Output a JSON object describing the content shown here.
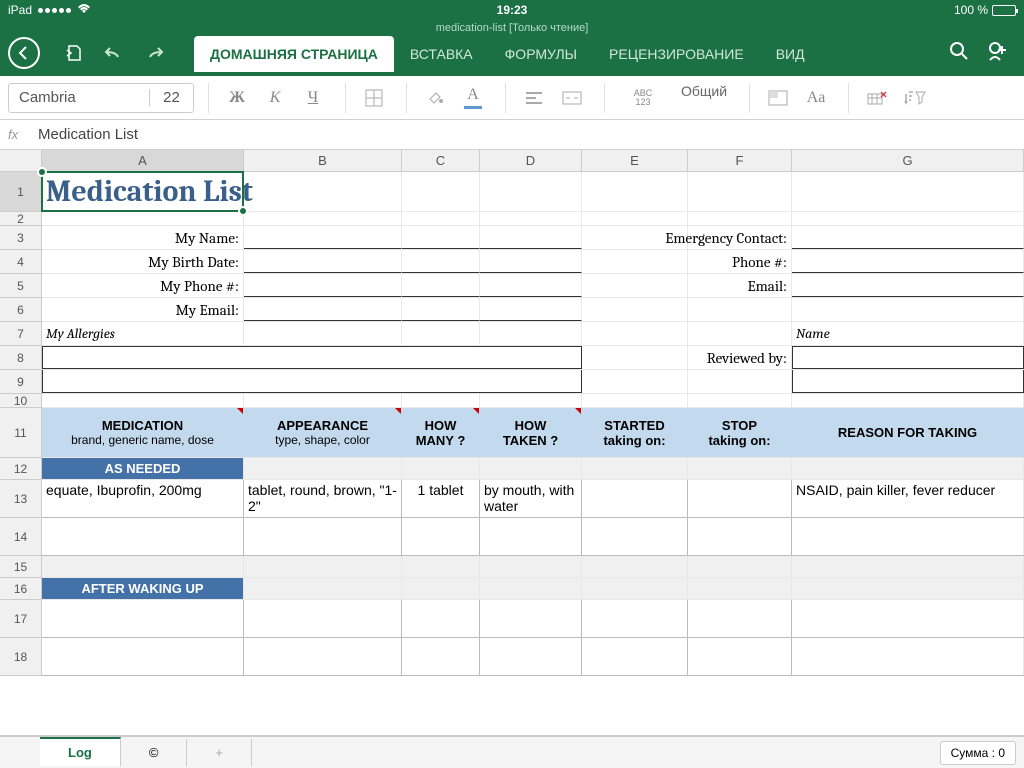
{
  "status": {
    "device": "iPad",
    "wifi": "wifi-icon",
    "time": "19:23",
    "battery_pct": "100 %"
  },
  "header": {
    "subtitle": "medication-list [Только чтение]",
    "tabs": [
      "ДОМАШНЯЯ СТРАНИЦА",
      "ВСТАВКА",
      "ФОРМУЛЫ",
      "РЕЦЕНЗИРОВАНИЕ",
      "ВИД"
    ]
  },
  "toolbar": {
    "font": "Cambria",
    "size": "22",
    "format": "Общий"
  },
  "formula": {
    "fx": "fx",
    "content": "Medication List"
  },
  "columns": [
    "A",
    "B",
    "C",
    "D",
    "E",
    "F",
    "G"
  ],
  "rows": [
    "1",
    "2",
    "3",
    "4",
    "5",
    "6",
    "7",
    "8",
    "9",
    "10",
    "11",
    "12",
    "13",
    "14",
    "15",
    "16",
    "17",
    "18"
  ],
  "doc": {
    "title": "Medication List",
    "labels": {
      "name": "My Name:",
      "birth": "My Birth Date:",
      "phone": "My Phone #:",
      "email": "My Email:",
      "emergency": "Emergency Contact:",
      "ephone": "Phone #:",
      "eemail": "Email:",
      "allergies": "My Allergies",
      "namehdr": "Name",
      "reviewed": "Reviewed by:"
    },
    "th": {
      "med": "MEDICATION",
      "med_sub": "brand, generic name, dose",
      "app": "APPEARANCE",
      "app_sub": "type, shape, color",
      "many": "HOW",
      "many_sub": "MANY ?",
      "taken": "HOW",
      "taken_sub": "TAKEN ?",
      "start": "STARTED",
      "start_sub": "taking on:",
      "stop": "STOP",
      "stop_sub": "taking on:",
      "reason": "REASON FOR TAKING"
    },
    "sections": {
      "asneeded": "AS NEEDED",
      "waking": "AFTER WAKING UP"
    },
    "row13": {
      "med": "equate, Ibuprofin, 200mg",
      "app": "tablet, round, brown, \"1-2\"",
      "many": "1 tablet",
      "taken": "by mouth, with water",
      "reason": "NSAID, pain killer, fever reducer"
    }
  },
  "sheets": {
    "log": "Log",
    "copy": "©",
    "plus": "+"
  },
  "footer": {
    "sum": "Сумма : 0"
  }
}
